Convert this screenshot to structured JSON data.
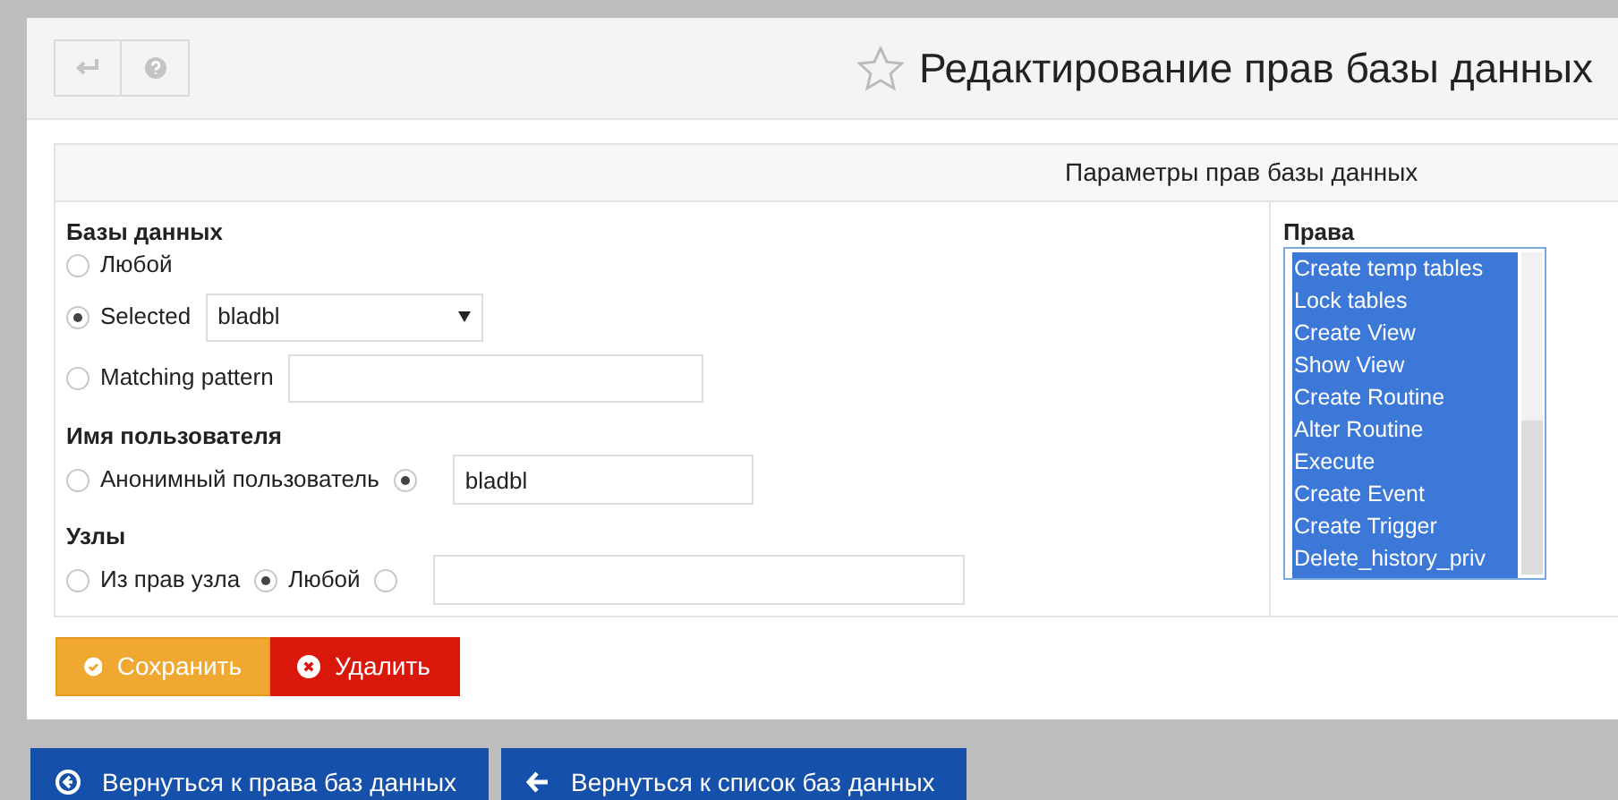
{
  "page_title": "Редактирование прав базы данных",
  "form_header": "Параметры прав базы данных",
  "databases": {
    "label": "Базы данных",
    "options": [
      {
        "kind": "plain",
        "label": "Любой",
        "selected": false
      },
      {
        "kind": "select",
        "label": "Selected",
        "selected": true,
        "value": "bladbl"
      },
      {
        "kind": "text",
        "label": "Matching pattern",
        "selected": false
      }
    ]
  },
  "user": {
    "label": "Имя пользователя",
    "options": [
      {
        "kind": "plain",
        "label": "Анонимный пользователь",
        "selected": false
      },
      {
        "kind": "text",
        "selected": true,
        "value": "bladbl"
      }
    ]
  },
  "hosts": {
    "label": "Узлы",
    "options": [
      {
        "kind": "plain",
        "label": "Из прав узла",
        "selected": false
      },
      {
        "kind": "plain",
        "label": "Любой",
        "selected": true
      },
      {
        "kind": "text",
        "selected": false
      }
    ]
  },
  "privileges": {
    "label": "Права",
    "items": [
      {
        "label": "Create temp tables",
        "selected": true
      },
      {
        "label": "Lock tables",
        "selected": true
      },
      {
        "label": "Create View",
        "selected": true
      },
      {
        "label": "Show View",
        "selected": true
      },
      {
        "label": "Create Routine",
        "selected": true
      },
      {
        "label": "Alter Routine",
        "selected": true
      },
      {
        "label": "Execute",
        "selected": true
      },
      {
        "label": "Create Event",
        "selected": true
      },
      {
        "label": "Create Trigger",
        "selected": true
      },
      {
        "label": "Delete_history_priv",
        "selected": true
      }
    ]
  },
  "actions": [
    "Сохранить",
    "Удалить"
  ],
  "nav_buttons": [
    "Вернуться к права баз данных",
    "Вернуться к список баз данных"
  ]
}
